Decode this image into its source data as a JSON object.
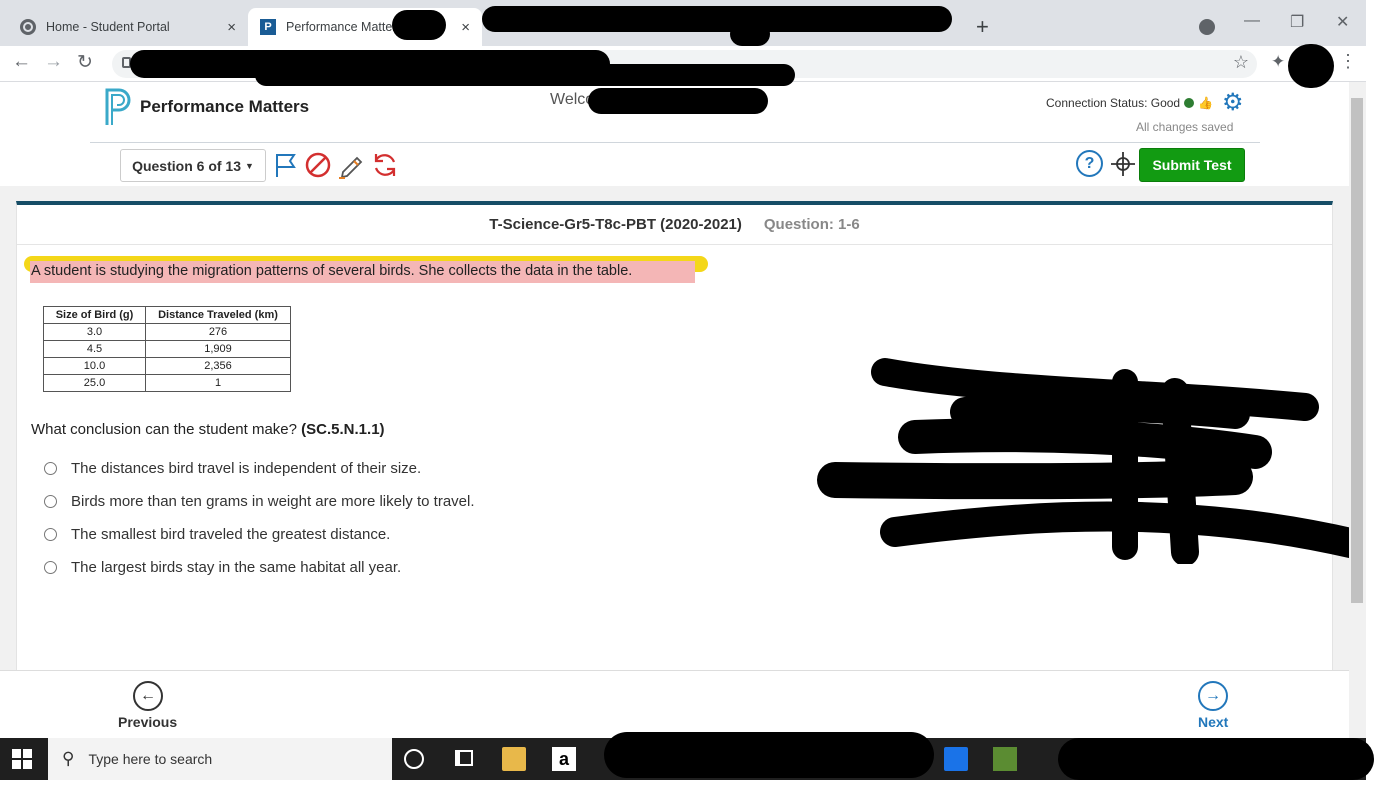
{
  "browser": {
    "tabs": [
      {
        "title": "Home - Student Portal",
        "active": false
      },
      {
        "title": "Performance Matters",
        "active": true
      }
    ],
    "new_tab": "+",
    "close_glyph": "×"
  },
  "app": {
    "brand": "Performance Matters",
    "welcome": "Welcome",
    "connection_status": "Connection Status: Good",
    "saved_status": "All changes saved"
  },
  "toolbar": {
    "question_select": "Question 6 of 13",
    "help": "?",
    "submit": "Submit Test",
    "tools": [
      "flag-icon",
      "eliminate-icon",
      "pencil-icon",
      "reset-icon",
      "help-icon",
      "crosshair-icon"
    ]
  },
  "question": {
    "test_name": "T-Science-Gr5-T8c-PBT (2020-2021)",
    "question_number": "Question: 1-6",
    "stem": "A student is studying the migration patterns of several birds. She collects the data in the table.",
    "table": {
      "headers": [
        "Size of Bird (g)",
        "Distance Traveled (km)"
      ],
      "rows": [
        [
          "3.0",
          "276"
        ],
        [
          "4.5",
          "1,909"
        ],
        [
          "10.0",
          "2,356"
        ],
        [
          "25.0",
          "1"
        ]
      ]
    },
    "prompt": "What conclusion can the student make?",
    "standard": "(SC.5.N.1.1)",
    "choices": [
      "The distances bird travel is independent of their size.",
      "Birds more than ten grams in weight are more likely to travel.",
      "The smallest bird traveled the greatest distance.",
      "The largest birds stay in the same habitat all year."
    ]
  },
  "footer": {
    "previous": "Previous",
    "next": "Next"
  },
  "taskbar": {
    "search_placeholder": "Type here to search"
  },
  "colors": {
    "accent": "#2277bb",
    "submit": "#129b12",
    "highlight": "#f4b6b6",
    "header_bar": "#164d66"
  }
}
